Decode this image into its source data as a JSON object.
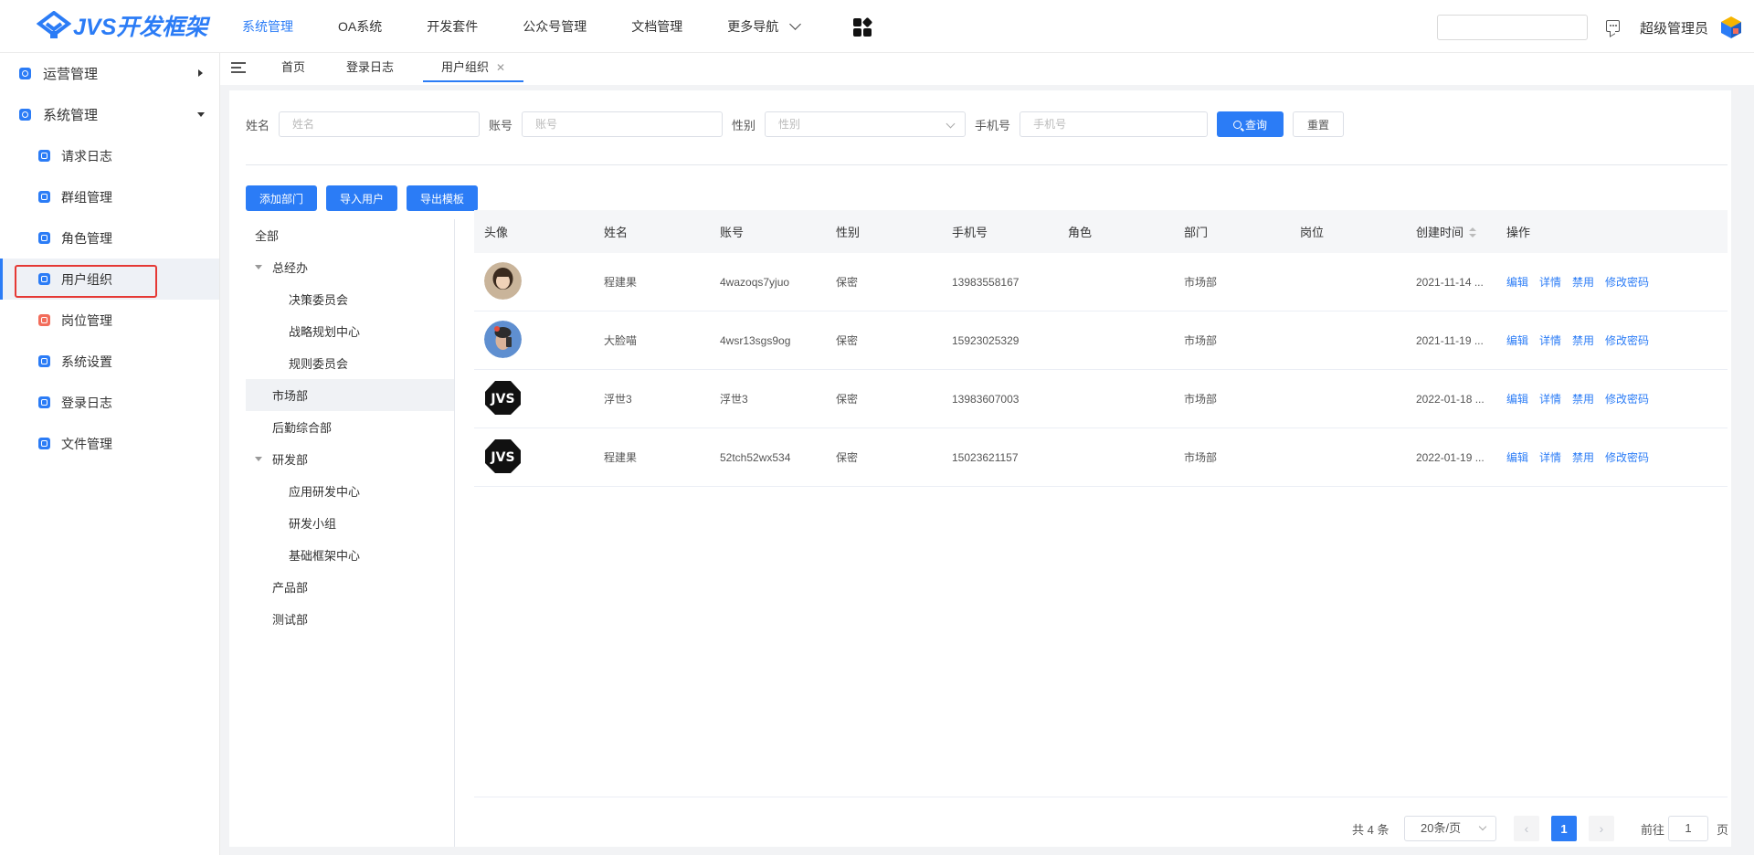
{
  "header": {
    "logo_text": "JVS开发框架",
    "nav": [
      "系统管理",
      "OA系统",
      "开发套件",
      "公众号管理",
      "文档管理",
      "更多导航"
    ],
    "active_nav": 0,
    "username": "超级管理员"
  },
  "sidebar": {
    "groups": [
      {
        "label": "运营管理",
        "expanded": false
      },
      {
        "label": "系统管理",
        "expanded": true
      }
    ],
    "items": [
      {
        "label": "请求日志"
      },
      {
        "label": "群组管理"
      },
      {
        "label": "角色管理"
      },
      {
        "label": "用户组织",
        "active": true
      },
      {
        "label": "岗位管理"
      },
      {
        "label": "系统设置"
      },
      {
        "label": "登录日志"
      },
      {
        "label": "文件管理"
      }
    ]
  },
  "tabs": [
    {
      "label": "首页"
    },
    {
      "label": "登录日志"
    },
    {
      "label": "用户组织",
      "active": true,
      "closable": true
    }
  ],
  "search": {
    "name_label": "姓名",
    "name_placeholder": "姓名",
    "account_label": "账号",
    "account_placeholder": "账号",
    "gender_label": "性别",
    "gender_placeholder": "性别",
    "phone_label": "手机号",
    "phone_placeholder": "手机号",
    "query_button": "查询",
    "reset_button": "重置"
  },
  "actions": {
    "add_dept": "添加部门",
    "import_users": "导入用户",
    "export_template": "导出模板"
  },
  "tree": [
    {
      "label": "全部",
      "level": 0,
      "arrow": false
    },
    {
      "label": "总经办",
      "level": 1,
      "arrow": true
    },
    {
      "label": "决策委员会",
      "level": 2,
      "arrow": false
    },
    {
      "label": "战略规划中心",
      "level": 2,
      "arrow": false
    },
    {
      "label": "规则委员会",
      "level": 2,
      "arrow": false
    },
    {
      "label": "市场部",
      "level": 1,
      "arrow": false,
      "selected": true
    },
    {
      "label": "后勤综合部",
      "level": 1,
      "arrow": false
    },
    {
      "label": "研发部",
      "level": 1,
      "arrow": true
    },
    {
      "label": "应用研发中心",
      "level": 2,
      "arrow": false
    },
    {
      "label": "研发小组",
      "level": 2,
      "arrow": false
    },
    {
      "label": "基础框架中心",
      "level": 2,
      "arrow": false
    },
    {
      "label": "产品部",
      "level": 1,
      "arrow": false
    },
    {
      "label": "测试部",
      "level": 1,
      "arrow": false
    }
  ],
  "table": {
    "columns": [
      "头像",
      "姓名",
      "账号",
      "性别",
      "手机号",
      "角色",
      "部门",
      "岗位",
      "创建时间",
      "操作"
    ],
    "rows": [
      {
        "avatar": "photo-girl",
        "name": "程建果",
        "account": "4wazoqs7yjuo",
        "gender": "保密",
        "phone": "13983558167",
        "role": "",
        "dept": "市场部",
        "post": "",
        "created": "2021-11-14 ..."
      },
      {
        "avatar": "photo-selfie",
        "name": "大脸喵",
        "account": "4wsr13sgs9og",
        "gender": "保密",
        "phone": "15923025329",
        "role": "",
        "dept": "市场部",
        "post": "",
        "created": "2021-11-19 ..."
      },
      {
        "avatar": "jvs-logo",
        "name": "浮世3",
        "account": "浮世3",
        "gender": "保密",
        "phone": "13983607003",
        "role": "",
        "dept": "市场部",
        "post": "",
        "created": "2022-01-18 ..."
      },
      {
        "avatar": "jvs-logo",
        "name": "程建果",
        "account": "52tch52wx534",
        "gender": "保密",
        "phone": "15023621157",
        "role": "",
        "dept": "市场部",
        "post": "",
        "created": "2022-01-19 ..."
      }
    ],
    "ops": [
      "编辑",
      "详情",
      "禁用",
      "修改密码"
    ]
  },
  "pagination": {
    "total_text": "共 4 条",
    "page_size": "20条/页",
    "current_page": "1",
    "goto_label": "前往",
    "goto_value": "1",
    "page_suffix": "页"
  },
  "colors": {
    "primary": "#2b7cf6",
    "highlight_box": "#e53935"
  }
}
